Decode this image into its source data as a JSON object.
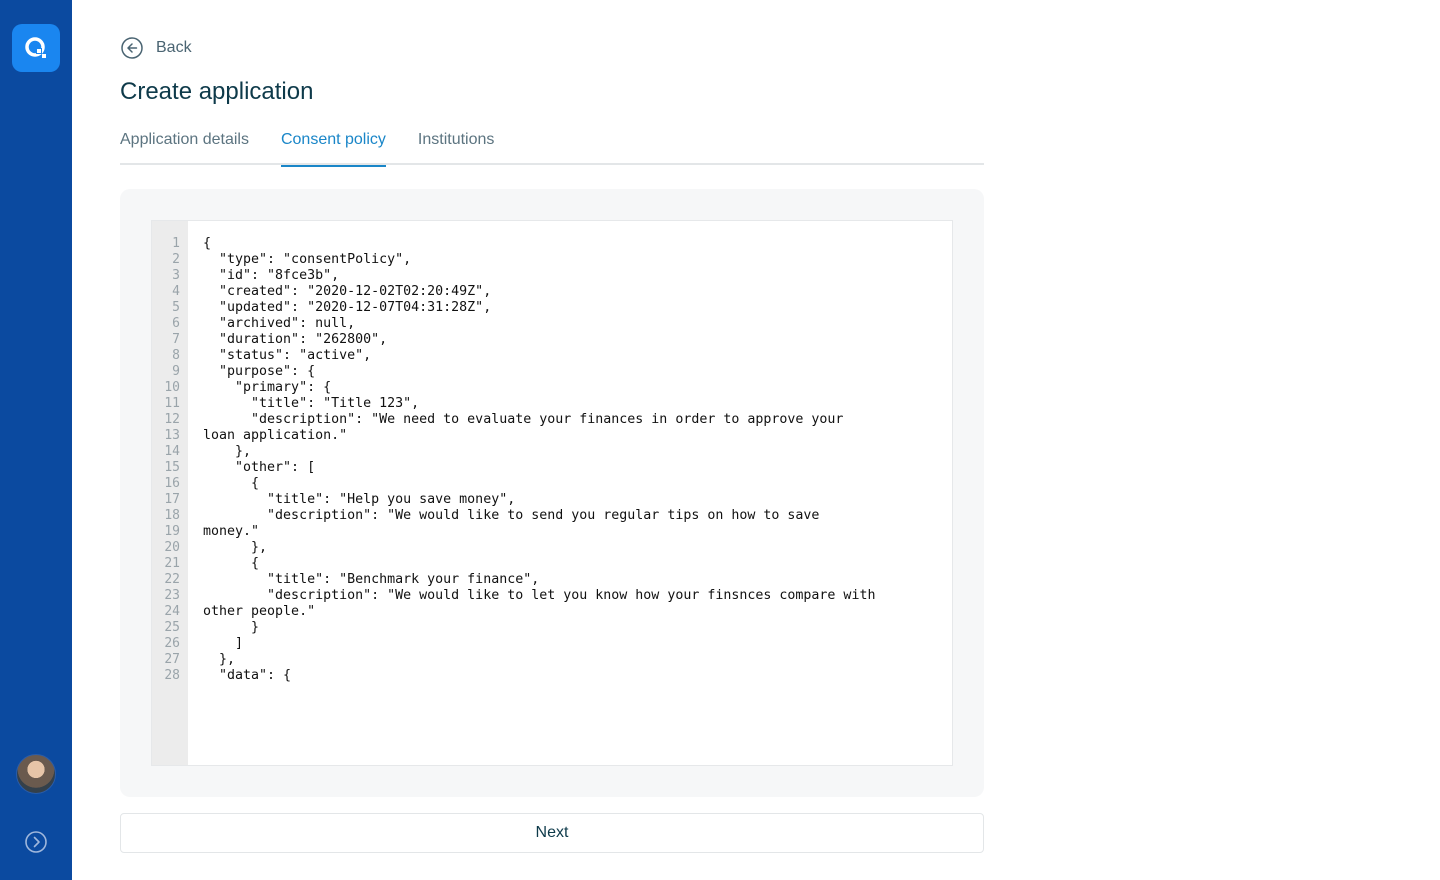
{
  "nav": {
    "back_label": "Back"
  },
  "page": {
    "title": "Create application"
  },
  "tabs": [
    {
      "label": "Application details"
    },
    {
      "label": "Consent policy"
    },
    {
      "label": "Institutions"
    }
  ],
  "editor": {
    "line_numbers": [
      "1",
      "2",
      "3",
      "4",
      "5",
      "6",
      "7",
      "8",
      "9",
      "10",
      "11",
      "12",
      "13",
      "14",
      "15",
      "16",
      "17",
      "18",
      "19",
      "20",
      "21",
      "22",
      "23",
      "24",
      "25",
      "26",
      "27",
      "28"
    ],
    "lines": [
      "{",
      "  \"type\": \"consentPolicy\",",
      "  \"id\": \"8fce3b\",",
      "  \"created\": \"2020-12-02T02:20:49Z\",",
      "  \"updated\": \"2020-12-07T04:31:28Z\",",
      "  \"archived\": null,",
      "  \"duration\": \"262800\",",
      "  \"status\": \"active\",",
      "  \"purpose\": {",
      "    \"primary\": {",
      "      \"title\": \"Title 123\",",
      "      \"description\": \"We need to evaluate your finances in order to approve your",
      "loan application.\"",
      "    },",
      "    \"other\": [",
      "      {",
      "        \"title\": \"Help you save money\",",
      "        \"description\": \"We would like to send you regular tips on how to save",
      "money.\"",
      "      },",
      "      {",
      "        \"title\": \"Benchmark your finance\",",
      "        \"description\": \"We would like to let you know how your finsnces compare with",
      "other people.\"",
      "      }",
      "    ]",
      "  },",
      "  \"data\": {"
    ]
  },
  "actions": {
    "next_label": "Next"
  },
  "colors": {
    "sidebar": "#0b4aa0",
    "logo": "#1a86f0",
    "accent": "#1a86c8"
  }
}
